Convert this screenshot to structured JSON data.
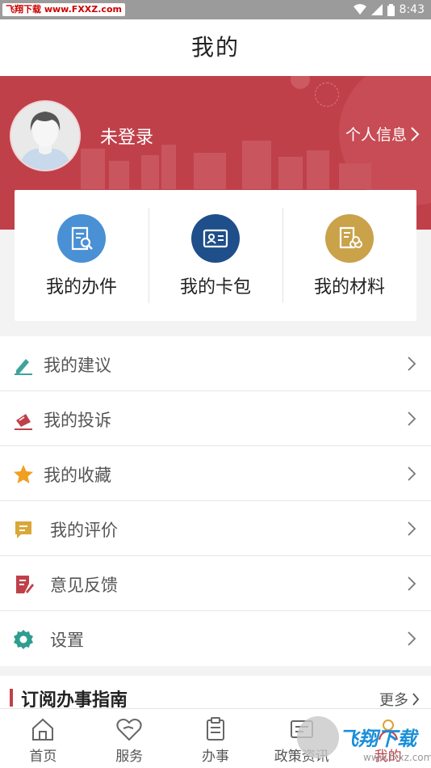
{
  "status_bar": {
    "watermark_site": "飞翔下载",
    "watermark_url": "www.FXXZ.com",
    "time": "8:43"
  },
  "header": {
    "title": "我的"
  },
  "profile": {
    "login_status": "未登录",
    "info_link": "个人信息"
  },
  "quick_actions": [
    {
      "label": "我的办件",
      "icon": "document-search-icon",
      "color": "#4a90d4"
    },
    {
      "label": "我的卡包",
      "icon": "id-card-icon",
      "color": "#1f4f8a"
    },
    {
      "label": "我的材料",
      "icon": "materials-icon",
      "color": "#c9a24a"
    }
  ],
  "menu": [
    {
      "label": "我的建议",
      "icon": "edit-icon",
      "color": "#3fa39a"
    },
    {
      "label": "我的投诉",
      "icon": "complaint-icon",
      "color": "#c0404a"
    },
    {
      "label": "我的收藏",
      "icon": "star-icon",
      "color": "#f0a020"
    },
    {
      "label": "我的评价",
      "icon": "comment-icon",
      "color": "#d9a83a"
    },
    {
      "label": "意见反馈",
      "icon": "feedback-icon",
      "color": "#c0404a"
    },
    {
      "label": "设置",
      "icon": "gear-icon",
      "color": "#2f9d8f"
    }
  ],
  "guide": {
    "title": "订阅办事指南",
    "more": "更多"
  },
  "tabs": [
    {
      "label": "首页",
      "icon": "home-icon"
    },
    {
      "label": "服务",
      "icon": "heart-tag-icon"
    },
    {
      "label": "办事",
      "icon": "clipboard-icon"
    },
    {
      "label": "政策资讯",
      "icon": "news-icon"
    },
    {
      "label": "我的",
      "icon": "person-icon"
    }
  ],
  "overlay_watermark": {
    "brand": "飞翔下载",
    "url": "www.fxxz.com"
  },
  "colors": {
    "brand_red": "#c0404a",
    "text_dark": "#222222",
    "text_muted": "#555555"
  }
}
